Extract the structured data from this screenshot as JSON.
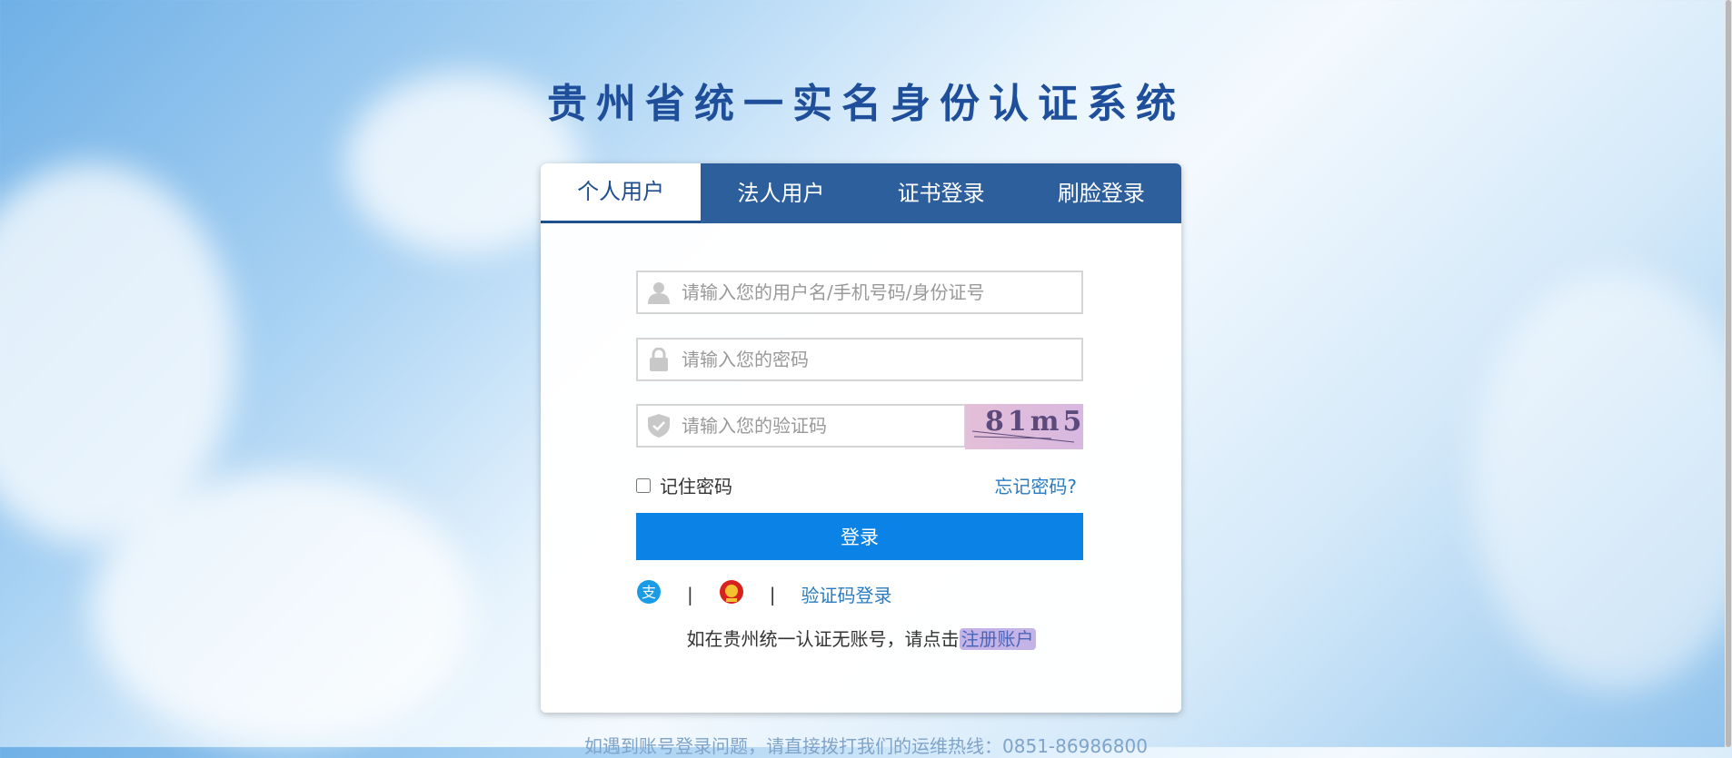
{
  "title": "贵州省统一实名身份认证系统",
  "tabs": [
    {
      "label": "个人用户",
      "active": true
    },
    {
      "label": "法人用户",
      "active": false
    },
    {
      "label": "证书登录",
      "active": false
    },
    {
      "label": "刷脸登录",
      "active": false
    }
  ],
  "form": {
    "username_placeholder": "请输入您的用户名/手机号码/身份证号",
    "password_placeholder": "请输入您的密码",
    "captcha_placeholder": "请输入您的验证码",
    "captcha_text": "81m5",
    "remember_label": "记住密码",
    "forgot_label": "忘记密码?",
    "login_label": "登录"
  },
  "alt_login": {
    "alipay_icon": "alipay-icon",
    "emblem_icon": "national-emblem-icon",
    "separator": "|",
    "sms_label": "验证码登录"
  },
  "register": {
    "prefix": "如在贵州统一认证无账号，请点击",
    "link": "注册账户"
  },
  "footer": "如遇到账号登录问题，请直接拨打我们的运维热线：0851-86986800",
  "colors": {
    "tab_bar": "#2d5f9c",
    "primary": "#0a82e6",
    "title": "#1f4f9a",
    "link": "#2a7bbf"
  }
}
